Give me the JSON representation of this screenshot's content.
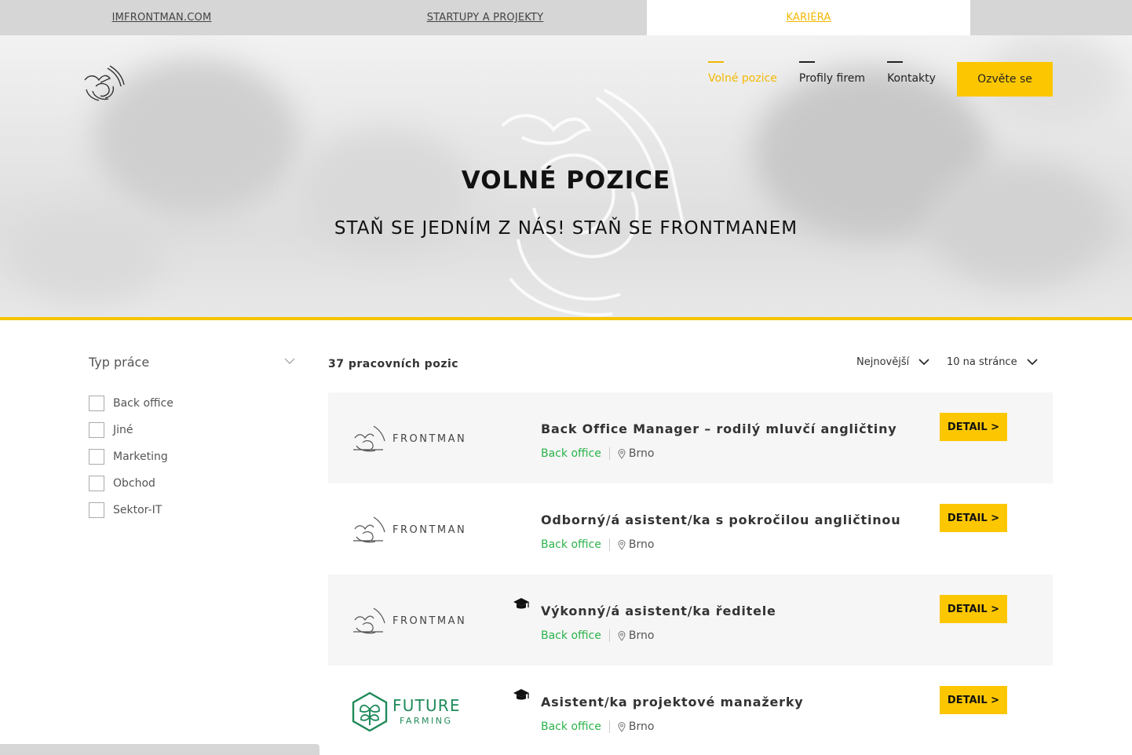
{
  "topstrip": {
    "links": [
      {
        "label": "IMFRONTMAN.COM"
      },
      {
        "label": "STARTUPY A PROJEKTY"
      },
      {
        "label": "KARIÉRA"
      }
    ]
  },
  "nav": {
    "items": [
      {
        "label": "Volné pozice"
      },
      {
        "label": "Profily firem"
      },
      {
        "label": "Kontakty"
      }
    ],
    "cta": "Ozvěte se"
  },
  "hero": {
    "title": "VOLNÉ POZICE",
    "subtitle": "STAŇ SE JEDNÍM Z NÁS! STAŇ SE FRONTMANEM"
  },
  "filter": {
    "title": "Typ práce",
    "options": [
      {
        "label": "Back office"
      },
      {
        "label": "Jiné"
      },
      {
        "label": "Marketing"
      },
      {
        "label": "Obchod"
      },
      {
        "label": "Sektor-IT"
      }
    ]
  },
  "results": {
    "count": "37 pracovních pozic",
    "sort": "Nejnovější",
    "per_page": "10 na stránce"
  },
  "jobs": [
    {
      "company": "FRONTMAN",
      "title": "Back Office Manager – rodilý mluvčí angličtiny",
      "category": "Back office",
      "location": "Brno",
      "detail": "DETAIL >"
    },
    {
      "company": "FRONTMAN",
      "title": "Odborný/á asistent/ka s pokročilou angličtinou",
      "category": "Back office",
      "location": "Brno",
      "detail": "DETAIL >"
    },
    {
      "company": "FRONTMAN",
      "title": "Výkonný/á asistent/ka ředitele",
      "category": "Back office",
      "location": "Brno",
      "detail": "DETAIL >"
    },
    {
      "company": "FUTURE",
      "company_sub": "FARMING",
      "title": "Asistent/ka projektové manažerky",
      "category": "Back office",
      "location": "Brno",
      "detail": "DETAIL >"
    }
  ],
  "colors": {
    "accent": "#fcc700",
    "category": "#2bb34a",
    "grey_bar": "#d6d6d6"
  }
}
